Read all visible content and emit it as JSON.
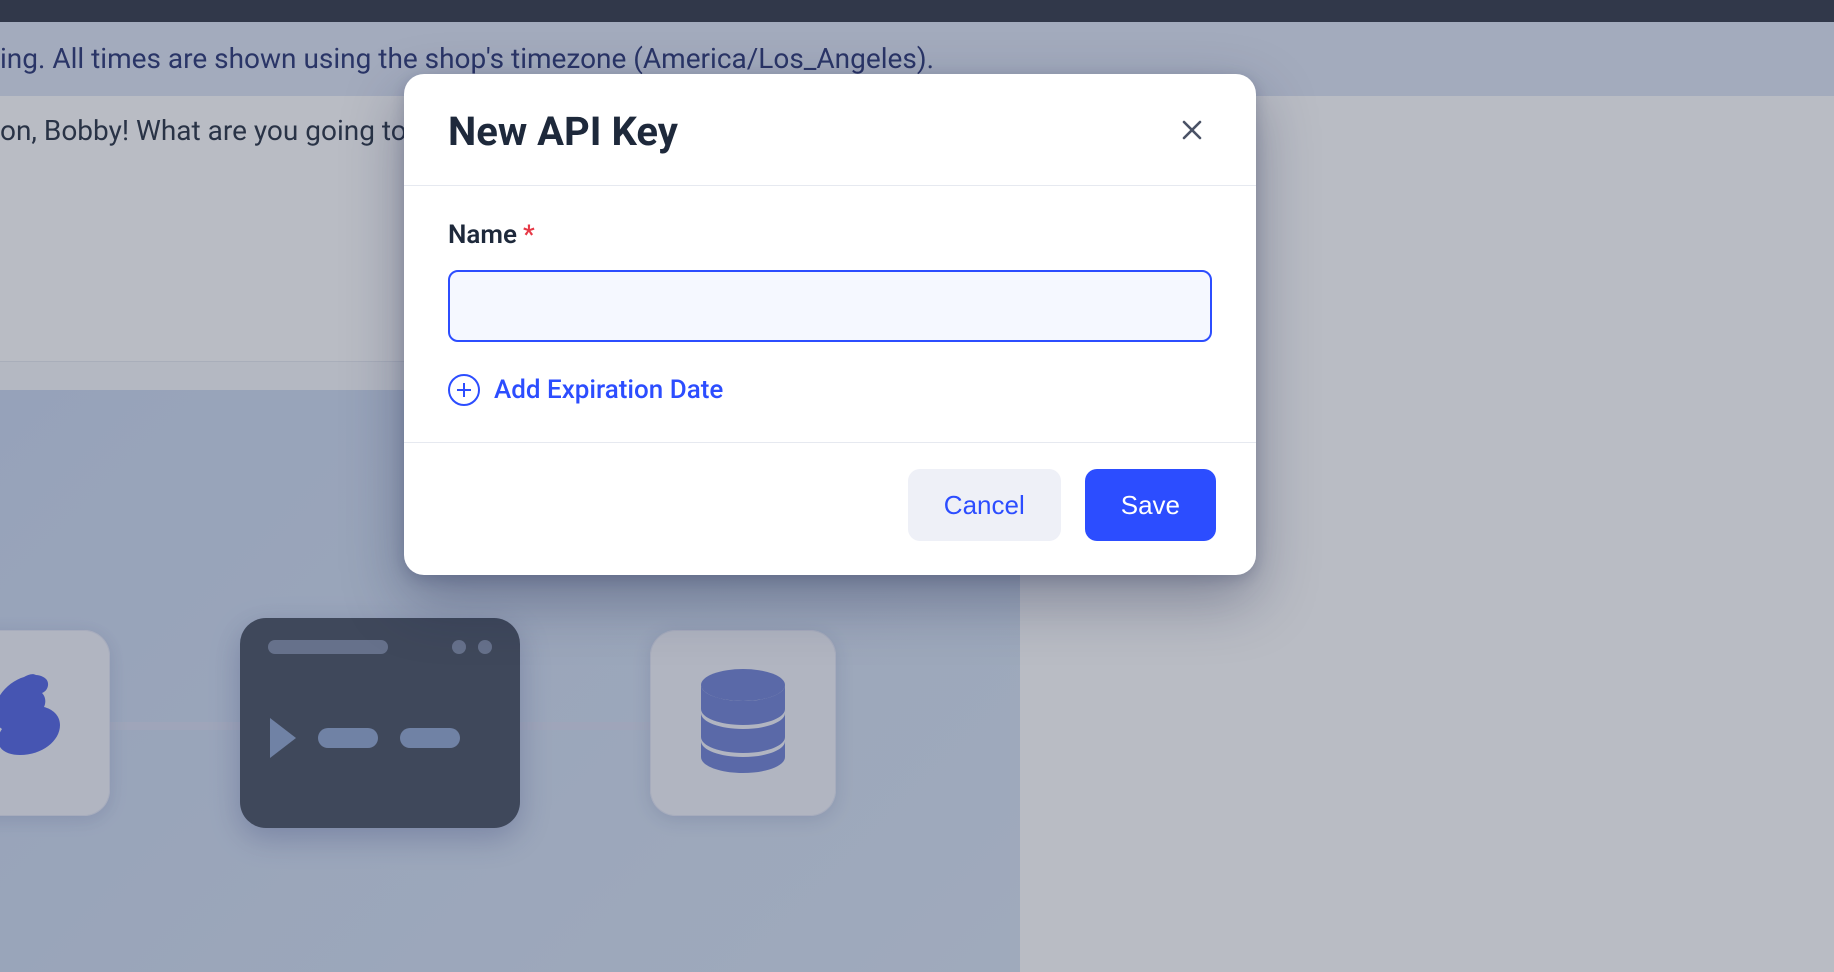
{
  "background": {
    "timezone_banner_text": "ing. All times are shown using the shop's timezone (America/Los_Angeles).",
    "greeting_text": "on, Bobby! What are you going to"
  },
  "modal": {
    "title": "New API Key",
    "fields": {
      "name": {
        "label": "Name",
        "required_mark": "*",
        "value": "",
        "placeholder": ""
      }
    },
    "add_expiration_label": "Add Expiration Date",
    "buttons": {
      "cancel": "Cancel",
      "save": "Save"
    }
  }
}
